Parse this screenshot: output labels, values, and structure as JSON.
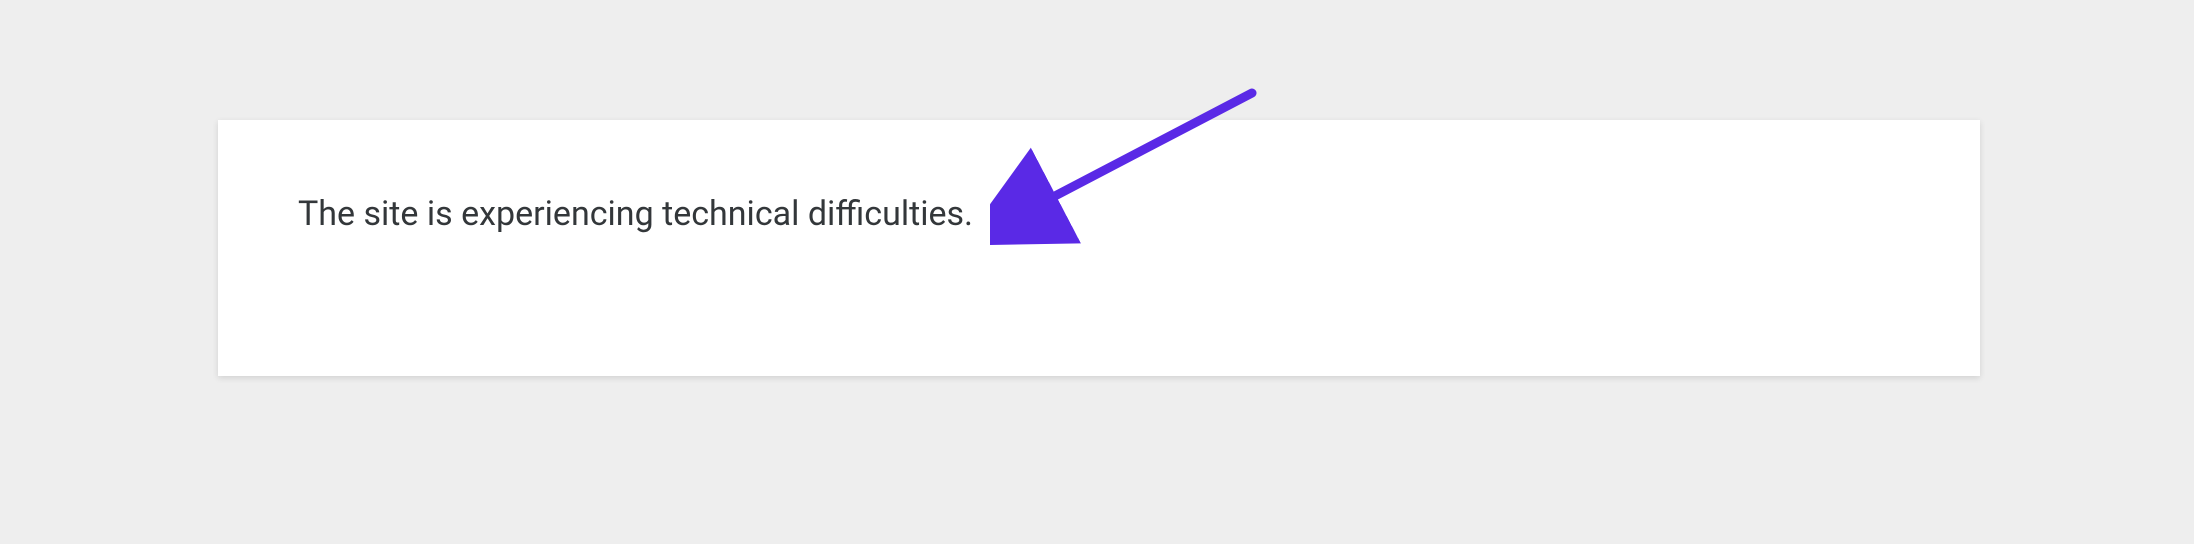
{
  "error": {
    "message": "The site is experiencing technical difficulties."
  },
  "annotation": {
    "arrow_color": "#5a29e6"
  }
}
